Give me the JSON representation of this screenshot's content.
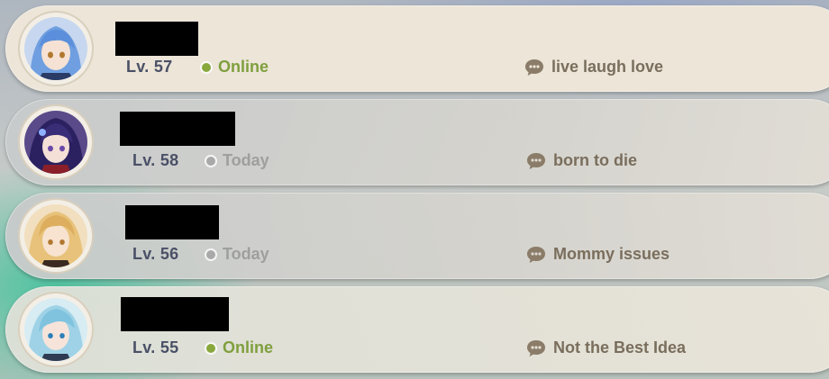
{
  "friends": [
    {
      "level": "Lv. 57",
      "status": "Online",
      "signature": "live laugh love"
    },
    {
      "level": "Lv. 58",
      "status": "Today",
      "signature": "born to die"
    },
    {
      "level": "Lv. 56",
      "status": "Today",
      "signature": "Mommy issues"
    },
    {
      "level": "Lv. 55",
      "status": "Online",
      "signature": "Not the Best Idea"
    }
  ],
  "colors": {
    "online": "#7f9f3e",
    "offline": "#9e9f9e",
    "level": "#4a5066",
    "signature": "#7a6e5d",
    "card_active": "#ece5d8"
  },
  "icons": {
    "status_dot": "status-dot-icon",
    "signature": "chat-bubble-icon"
  }
}
